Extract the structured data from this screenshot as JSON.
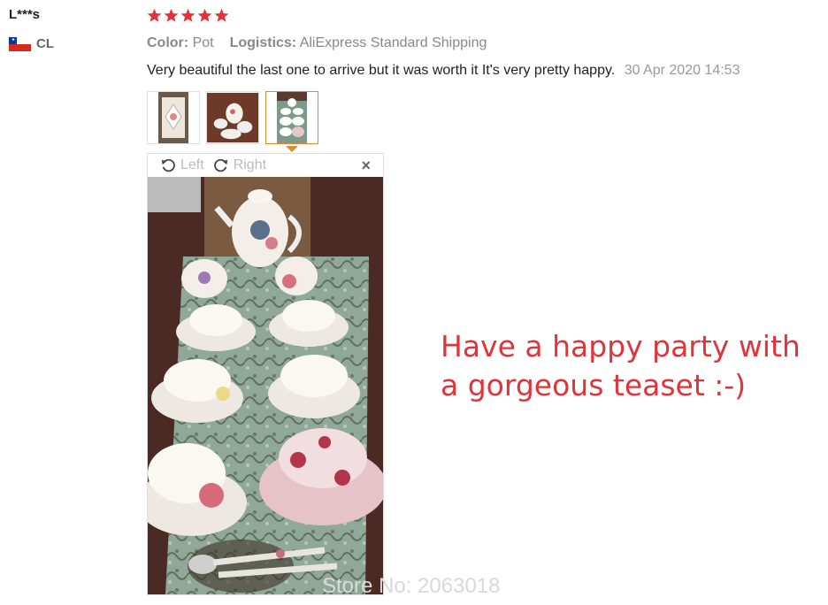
{
  "reviewer": {
    "name": "L***s",
    "country_code": "CL",
    "flag_icon": "chile-flag-icon"
  },
  "rating": {
    "stars": 5,
    "max": 5,
    "color": "#e2323a"
  },
  "meta": {
    "color_label": "Color:",
    "color_value": "Pot",
    "logistics_label": "Logistics:",
    "logistics_value": "AliExpress Standard Shipping"
  },
  "review": {
    "text": "Very beautiful the last one to arrive but it was worth it It's very pretty happy.",
    "date": "30 Apr 2020 14:53"
  },
  "thumbnails": [
    {
      "name": "thumbnail-1",
      "active": false
    },
    {
      "name": "thumbnail-2",
      "active": false
    },
    {
      "name": "thumbnail-3",
      "active": true
    }
  ],
  "viewer": {
    "rotate_left_label": "Left",
    "rotate_right_label": "Right",
    "close_label": "×"
  },
  "promo": {
    "line1": "Have a happy party with",
    "line2": "a gorgeous teaset :-)"
  },
  "watermark": "Store No: 2063018",
  "colors": {
    "accent": "#e38a2d",
    "promo": "#e2323a"
  }
}
